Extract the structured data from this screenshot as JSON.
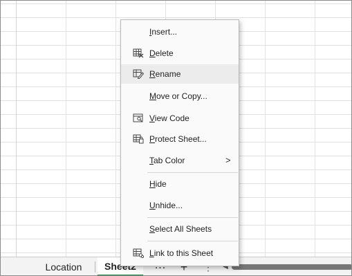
{
  "tabs": {
    "sheets": [
      "Location",
      "Sheet2"
    ],
    "more_label": "...",
    "add_label": "+",
    "vdots_label": "⋮",
    "scroll_left": "◀"
  },
  "context_menu": {
    "items": [
      {
        "accel": "I",
        "rest": "nsert...",
        "icon": ""
      },
      {
        "accel": "D",
        "rest": "elete",
        "icon": "delete-sheet-icon"
      },
      {
        "accel": "R",
        "rest": "ename",
        "icon": "rename-sheet-icon",
        "highlighted": true
      },
      {
        "accel": "M",
        "rest": "ove or Copy...",
        "icon": ""
      },
      {
        "accel": "V",
        "rest": "iew Code",
        "icon": "view-code-icon"
      },
      {
        "accel": "P",
        "rest": "rotect Sheet...",
        "icon": "protect-sheet-icon"
      },
      {
        "accel": "T",
        "rest": "ab Color",
        "icon": "",
        "submenu_glyph": ">"
      },
      {
        "accel": "H",
        "rest": "ide",
        "icon": ""
      },
      {
        "accel": "U",
        "rest": "nhide...",
        "icon": ""
      },
      {
        "accel": "S",
        "rest": "elect All Sheets",
        "icon": ""
      },
      {
        "accel": "L",
        "rest": "ink to this Sheet",
        "icon": "link-sheet-icon"
      }
    ]
  },
  "colors": {
    "active_tab_underline": "#117e3a",
    "menu_background": "#fafafa",
    "menu_highlight": "#ececec"
  }
}
